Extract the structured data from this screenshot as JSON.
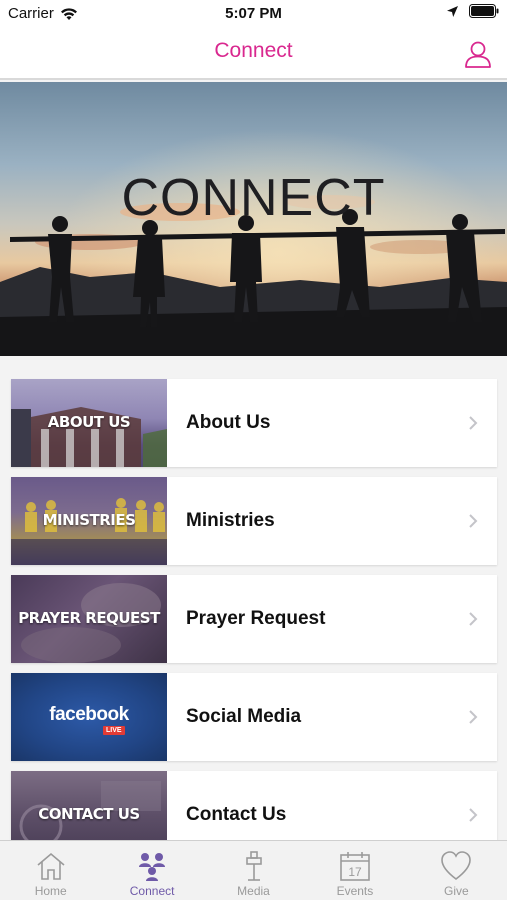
{
  "status": {
    "carrier": "Carrier",
    "time": "5:07 PM"
  },
  "nav": {
    "title": "Connect"
  },
  "hero": {
    "title": "CONNECT"
  },
  "cards": [
    {
      "thumb_label": "ABOUT US",
      "label": "About Us",
      "thumb_icon": "church-photo"
    },
    {
      "thumb_label": "MINISTRIES",
      "label": "Ministries",
      "thumb_icon": "choir-photo"
    },
    {
      "thumb_label": "PRAYER REQUEST",
      "label": "Prayer Request",
      "thumb_icon": "praying-hands-photo"
    },
    {
      "thumb_label": "facebook",
      "thumb_badge": "LIVE",
      "label": "Social Media",
      "thumb_icon": "facebook-live-logo"
    },
    {
      "thumb_label": "CONTACT US",
      "label": "Contact Us",
      "thumb_icon": "contact-photo"
    }
  ],
  "tabs": [
    {
      "label": "Home",
      "icon": "home-icon",
      "active": false
    },
    {
      "label": "Connect",
      "icon": "people-icon",
      "active": true
    },
    {
      "label": "Media",
      "icon": "media-icon",
      "active": false
    },
    {
      "label": "Events",
      "icon": "calendar-icon",
      "active": false,
      "calendar_day": "17"
    },
    {
      "label": "Give",
      "icon": "heart-icon",
      "active": false
    }
  ],
  "colors": {
    "accent": "#d9288f",
    "tab_active": "#6f5aa8",
    "tab_inactive": "#9a9a9a"
  }
}
